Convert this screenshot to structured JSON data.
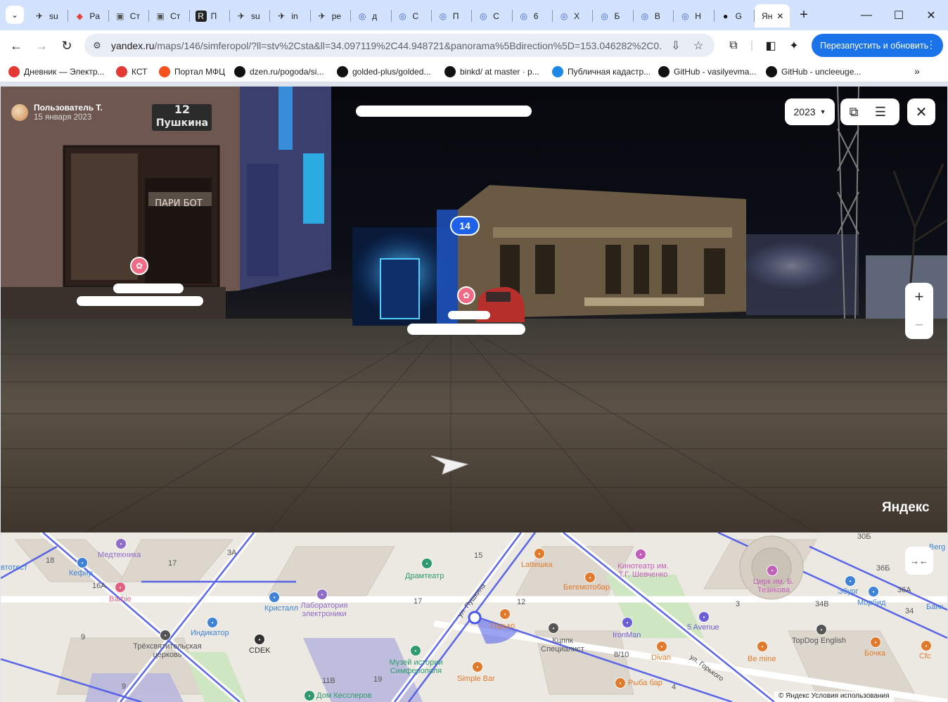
{
  "browser": {
    "tabs": [
      {
        "label": "su",
        "icon": "bird"
      },
      {
        "label": "Pa",
        "icon": "red-diamond"
      },
      {
        "label": "Ст",
        "icon": "mono"
      },
      {
        "label": "Ст",
        "icon": "mono"
      },
      {
        "label": "П",
        "icon": "r-box"
      },
      {
        "label": "su",
        "icon": "bird"
      },
      {
        "label": "in",
        "icon": "bird"
      },
      {
        "label": "pe",
        "icon": "bird"
      },
      {
        "label": "д",
        "icon": "pin"
      },
      {
        "label": "С",
        "icon": "pin"
      },
      {
        "label": "П",
        "icon": "pin"
      },
      {
        "label": "С",
        "icon": "pin"
      },
      {
        "label": "6",
        "icon": "pin"
      },
      {
        "label": "Х",
        "icon": "pin"
      },
      {
        "label": "Б",
        "icon": "pin"
      },
      {
        "label": "В",
        "icon": "pin"
      },
      {
        "label": "Н",
        "icon": "pin"
      },
      {
        "label": "G",
        "icon": "github"
      }
    ],
    "active_tab": {
      "label": "Ян",
      "close": "✕"
    },
    "new_tab": "+",
    "window_controls": {
      "minimize": "—",
      "maximize": "☐",
      "close": "✕"
    },
    "url": {
      "host": "yandex.ru",
      "rest": "/maps/146/simferopol/?ll=stv%2Csta&ll=34.097119%2C44.948721&panorama%5Bdirection%5D=153.046282%2C0...."
    },
    "restart_button": "Перезапустить и обновить",
    "bookmarks": [
      {
        "label": "Дневник — Электр...",
        "color": "#e53935"
      },
      {
        "label": "КСТ",
        "color": "#e53935"
      },
      {
        "label": "Портал МФЦ",
        "color": "#f4511e"
      },
      {
        "label": "dzen.ru/pogoda/si...",
        "color": "#111111"
      },
      {
        "label": "golded-plus/golded...",
        "color": "#111111"
      },
      {
        "label": "binkd/ at master · p...",
        "color": "#111111"
      },
      {
        "label": "Публичная кадастр...",
        "color": "#1e88e5"
      },
      {
        "label": "GitHub - vasilyevma...",
        "color": "#111111"
      },
      {
        "label": "GitHub - uncleeuge...",
        "color": "#111111"
      }
    ],
    "bookmarks_more": "»"
  },
  "panorama": {
    "user_name": "Пользователь Т.",
    "date": "15 января 2023",
    "year": "2023",
    "badge": "14",
    "logo": "Яндекс",
    "zoom_in": "+",
    "zoom_out": "−",
    "sign_number": "12",
    "sign_street": "Пушкина",
    "shop_sign": "ПАРИ БОТ"
  },
  "map": {
    "labels": [
      {
        "text": "Медтехника",
        "color": "#8e6cc8"
      },
      {
        "text": "Кефир",
        "color": "#3f83d6"
      },
      {
        "text": "Barbie",
        "color": "#e0607f"
      },
      {
        "text": "втотест",
        "color": "#3f83d6"
      },
      {
        "text": "Кристалл",
        "color": "#3f83d6"
      },
      {
        "text": "Лаборатория электроники",
        "color": "#8e6cc8"
      },
      {
        "text": "Индикатор",
        "color": "#3f83d6"
      },
      {
        "text": "CDEK",
        "color": "#333333"
      },
      {
        "text": "Трёхсвятительская церковь",
        "color": "#555555"
      },
      {
        "text": "Драмтеатр",
        "color": "#2f9a6f"
      },
      {
        "text": "Lattешка",
        "color": "#e07b2e"
      },
      {
        "text": "Бегемотобар",
        "color": "#e07b2e"
      },
      {
        "text": "Кинотеатр им. Т.Г. Шевченко",
        "color": "#c25fb8"
      },
      {
        "text": "Цирк им. Б. Тезикова",
        "color": "#c25fb8"
      },
      {
        "text": "Эбург",
        "color": "#3f83d6"
      },
      {
        "text": "Морбид",
        "color": "#3f83d6"
      },
      {
        "text": "Банк",
        "color": "#3f83d6"
      },
      {
        "text": "Кцппк Специалист",
        "color": "#555555"
      },
      {
        "text": "IronMan",
        "color": "#6c5fd6"
      },
      {
        "text": "5 Avenue",
        "color": "#6c5fd6"
      },
      {
        "text": "TopDog English",
        "color": "#555555"
      },
      {
        "text": "Бочка",
        "color": "#e07b2e"
      },
      {
        "text": "Cfc",
        "color": "#e07b2e"
      },
      {
        "text": "Divan",
        "color": "#e07b2e"
      },
      {
        "text": "Be mine",
        "color": "#e07b2e"
      },
      {
        "text": "Рыба бар",
        "color": "#e07b2e"
      },
      {
        "text": "Simple Bar",
        "color": "#e07b2e"
      },
      {
        "text": "Музей истории Симферополя",
        "color": "#2f9a6f"
      },
      {
        "text": "Дом Кесслеров",
        "color": "#2f9a6f"
      },
      {
        "text": "Горько",
        "color": "#e07b2e"
      },
      {
        "text": "ул. Пушкина",
        "color": "#444444"
      },
      {
        "text": "ул. Горького",
        "color": "#444444"
      },
      {
        "text": "Berg",
        "color": "#3f83d6"
      }
    ],
    "house_numbers": [
      "18",
      "17",
      "3А",
      "16А",
      "15",
      "17",
      "12",
      "9",
      "11В",
      "19",
      "9",
      "8/10",
      "3",
      "34В",
      "4",
      "36Б",
      "36А",
      "34",
      "30Б"
    ],
    "footer": "© Яндекс   Условия использования"
  }
}
